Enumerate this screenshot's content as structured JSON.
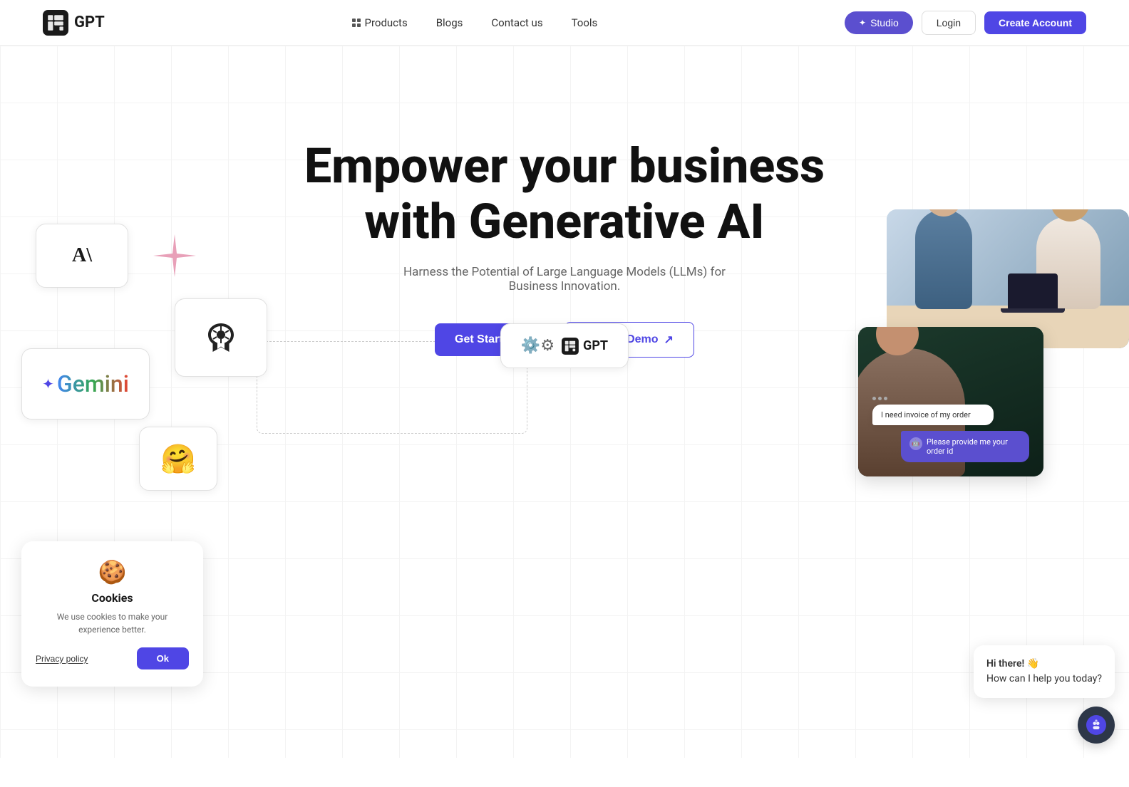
{
  "navbar": {
    "logo_text": "GPT",
    "nav_products": "Products",
    "nav_blogs": "Blogs",
    "nav_contact": "Contact us",
    "nav_tools": "Tools",
    "btn_studio": "Studio",
    "btn_login": "Login",
    "btn_create": "Create Account"
  },
  "hero": {
    "title_line1": "Empower your business",
    "title_line2": "with Generative AI",
    "subtitle": "Harness the Potential of Large Language Models (LLMs) for Business Innovation.",
    "btn_get_started": "Get Started",
    "btn_book_demo": "Book a Demo"
  },
  "center_card": {
    "logo": "GPT"
  },
  "chat_overlay": {
    "user_msg": "I need invoice of my order",
    "bot_msg": "Please provide me your order id"
  },
  "cookie": {
    "title": "Cookies",
    "text": "We use cookies to make your experience better.",
    "btn_privacy": "Privacy policy",
    "btn_ok": "Ok"
  },
  "chat_widget": {
    "greeting": "Hi there! 👋",
    "subtitle": "How can I help you today?"
  }
}
